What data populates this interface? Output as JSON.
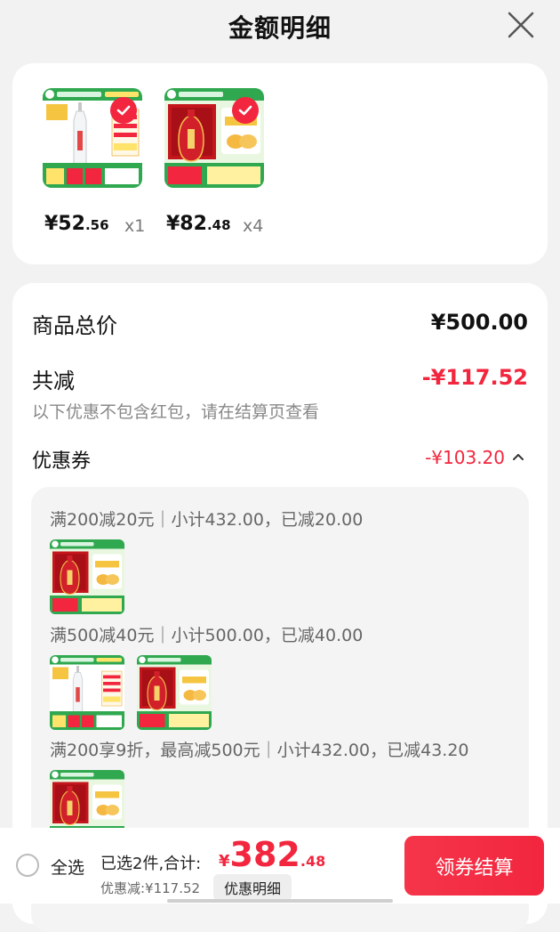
{
  "header": {
    "title": "金额明细"
  },
  "products": [
    {
      "price_int": "¥52",
      "price_dec": ".56",
      "qty": "x1",
      "image": "baijiu-clear-bottle-product",
      "selected": true
    },
    {
      "price_int": "¥82",
      "price_dec": ".48",
      "qty": "x4",
      "image": "red-baijiu-gift-box-product",
      "selected": true
    }
  ],
  "summary": {
    "total_label": "商品总价",
    "total_value": "¥500.00",
    "reduce_label": "共减",
    "reduce_value": "-¥117.52",
    "note": "以下优惠不包含红包，请在结算页查看",
    "coupon_label": "优惠券",
    "coupon_value": "-¥103.20",
    "coupon_icon": "chevron-up-icon"
  },
  "coupons": [
    {
      "rule": "满200减20元｜小计432.00，已减20.00"
    },
    {
      "rule": "满500减40元｜小计500.00，已减40.00"
    },
    {
      "rule": "满200享9折，最高减500元｜小计432.00，已减43.20"
    }
  ],
  "bottom": {
    "select_all": "全选",
    "selected_text": "已选2件,合计:",
    "total_symbol": "¥",
    "total_int": "382",
    "total_dec": ".48",
    "discount_text": "优惠减:¥117.52",
    "detail_button": "优惠明细",
    "cta": "领券结算"
  },
  "colors": {
    "accent": "#f2263e",
    "green": "#2fa84f",
    "product_red": "#c4161c"
  }
}
